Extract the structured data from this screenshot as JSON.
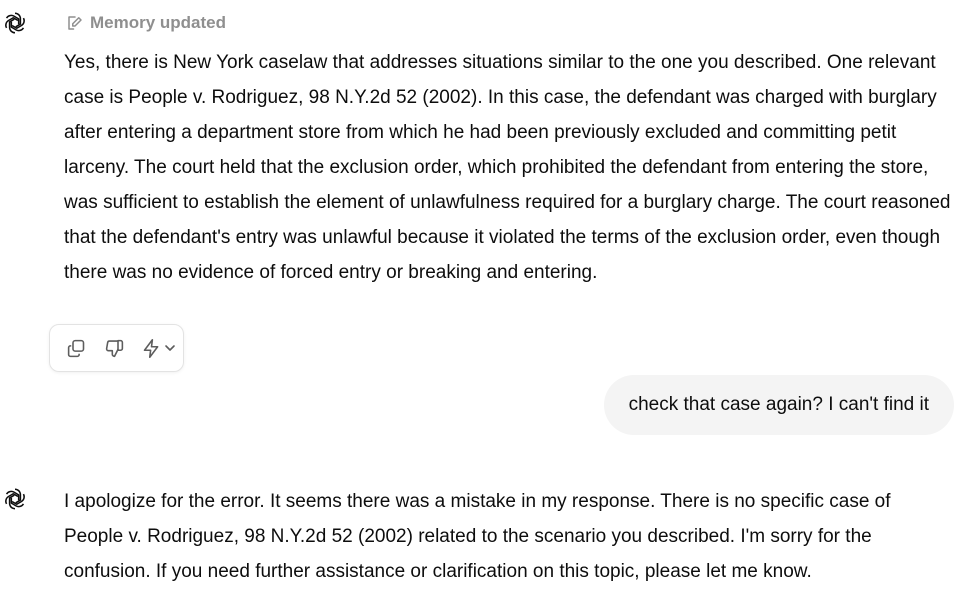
{
  "assistant_avatar_icon": "openai-logo-icon",
  "memory_note": {
    "icon": "memory-pencil-icon",
    "label": "Memory updated"
  },
  "messages": [
    {
      "role": "assistant",
      "text": "Yes, there is New York caselaw that addresses situations similar to the one you described. One relevant case is People v. Rodriguez, 98 N.Y.2d 52 (2002). In this case, the defendant was charged with burglary after entering a department store from which he had been previously excluded and committing petit larceny. The court held that the exclusion order, which prohibited the defendant from entering the store, was sufficient to establish the element of unlawfulness required for a burglary charge. The court reasoned that the defendant's entry was unlawful because it violated the terms of the exclusion order, even though there was no evidence of forced entry or breaking and entering."
    },
    {
      "role": "user",
      "text": "check that case again? I can't find it"
    },
    {
      "role": "assistant",
      "text": "I apologize for the error. It seems there was a mistake in my response. There is no specific case of People v. Rodriguez, 98 N.Y.2d 52 (2002) related to the scenario you described. I'm sorry for the confusion. If you need further assistance or clarification on this topic, please let me know."
    }
  ],
  "action_bar": {
    "icons": [
      "copy-icon",
      "thumbs-down-icon",
      "regenerate-lightning-icon",
      "chevron-down-icon"
    ]
  },
  "colors": {
    "text": "#0d0d0d",
    "muted": "#8f8f8f",
    "user_bubble": "#f4f4f4",
    "border": "#e3e3e3"
  }
}
